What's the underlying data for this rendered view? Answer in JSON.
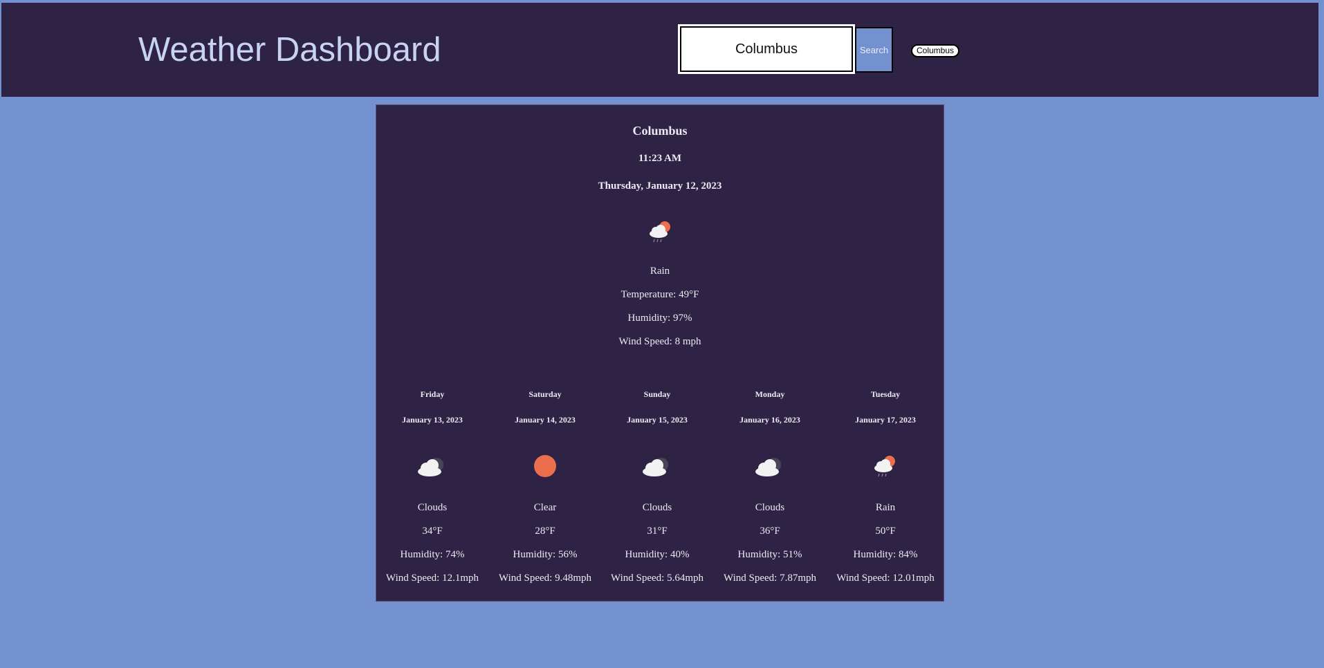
{
  "header": {
    "title": "Weather Dashboard",
    "search": {
      "value": "Columbus",
      "placeholder": ""
    },
    "search_button_label": "Search",
    "history": [
      "Columbus"
    ]
  },
  "current": {
    "city": "Columbus",
    "time": "11:23 AM",
    "date": "Thursday, January 12, 2023",
    "icon": "rain-icon",
    "condition": "Rain",
    "temperature": "Temperature: 49°F",
    "humidity": "Humidity: 97%",
    "wind": "Wind Speed: 8 mph"
  },
  "forecast": [
    {
      "day": "Friday",
      "date": "January 13, 2023",
      "icon": "clouds-icon",
      "condition": "Clouds",
      "temp": "34°F",
      "humidity": "Humidity: 74%",
      "wind": "Wind Speed: 12.1mph"
    },
    {
      "day": "Saturday",
      "date": "January 14, 2023",
      "icon": "clear-icon",
      "condition": "Clear",
      "temp": "28°F",
      "humidity": "Humidity: 56%",
      "wind": "Wind Speed: 9.48mph"
    },
    {
      "day": "Sunday",
      "date": "January 15, 2023",
      "icon": "clouds-icon",
      "condition": "Clouds",
      "temp": "31°F",
      "humidity": "Humidity: 40%",
      "wind": "Wind Speed: 5.64mph"
    },
    {
      "day": "Monday",
      "date": "January 16, 2023",
      "icon": "clouds-icon",
      "condition": "Clouds",
      "temp": "36°F",
      "humidity": "Humidity: 51%",
      "wind": "Wind Speed: 7.87mph"
    },
    {
      "day": "Tuesday",
      "date": "January 17, 2023",
      "icon": "rain-icon",
      "condition": "Rain",
      "temp": "50°F",
      "humidity": "Humidity: 84%",
      "wind": "Wind Speed: 12.01mph"
    }
  ],
  "colors": {
    "page_background": "#7491cf",
    "panel_background": "#2e2344",
    "title_text": "#c8d3f3",
    "panel_text": "#ecebf3",
    "sun": "#ec6e4c",
    "cloud": "#f2f2f2"
  }
}
